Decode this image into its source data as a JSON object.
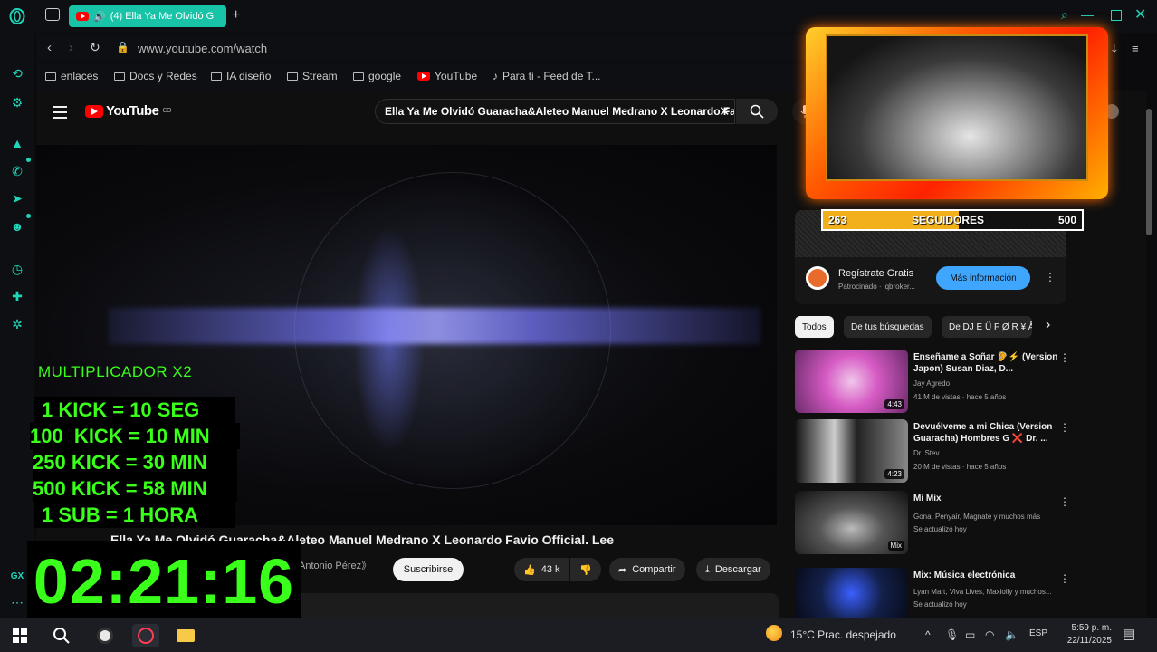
{
  "browser": {
    "tab_title": "(4) Ella Ya Me Olvidó G",
    "url": "www.youtube.com/watch",
    "bookmarks": [
      "enlaces",
      "Docs y Redes",
      "IA diseño",
      "Stream",
      "google",
      "YouTube",
      "Para ti - Feed de T..."
    ],
    "accent": "#18c3a8"
  },
  "youtube": {
    "logo": "YouTube",
    "logo_sup": "CO",
    "search_query": "Ella Ya Me Olvidó Guaracha&Aleteo Manuel Medrano X Leonardo Favi",
    "video_title": "Ella Ya Me Olvidó Guaracha&Aleteo Manuel Medrano X Leonardo Favio Official. Lee",
    "channel": "Antonio Pérez》",
    "subscribe": "Suscribirse",
    "likes": "43 k",
    "share": "Compartir",
    "download": "Descargar",
    "ad": {
      "name": "Regístrate Gratis",
      "sponsor": "Patrocinado · iqbroker...",
      "cta": "Más información"
    },
    "chips": [
      "Todos",
      "De tus búsquedas",
      "De DJ E Ü F Ø R ¥ Å"
    ],
    "recommendations": [
      {
        "title": "Enseñame a Soñar 🦻⚡ (Version Japon) Susan Diaz, D...",
        "channel": "Jay Agredo",
        "meta": "41 M de vistas · hace 5 años",
        "duration": "4:43"
      },
      {
        "title": "Devuélveme a mi Chica (Version Guaracha) Hombres G ❌ Dr. ...",
        "channel": "Dr. Stev",
        "meta": "20 M de vistas · hace 5 años",
        "duration": "4:23"
      },
      {
        "title": "Mi Mix",
        "channel": "Gona, Penyair, Magnate y muchos más",
        "meta": "Se actualizó hoy",
        "duration": "Mix"
      },
      {
        "title": "Mix: Música electrónica",
        "channel": "Lyan Mart, Viva Lives, Maxiolly y muchos...",
        "meta": "Se actualizó hoy",
        "duration": ""
      }
    ]
  },
  "overlay": {
    "followers": {
      "current": "263",
      "label": "SEGUIDORES",
      "goal": "500",
      "fraction": 0.526
    },
    "multiplier": "MULTIPLICADOR X2",
    "rules": [
      "1 KICK = 10 SEG",
      "100  KICK = 10 MIN",
      "250 KICK = 30 MIN",
      "500 KICK = 58 MIN",
      "1 SUB = 1 HORA"
    ],
    "timer": "02:21:16",
    "timer_color": "#39ff1a"
  },
  "taskbar": {
    "weather": "15°C  Prac. despejado",
    "lang": "ESP",
    "time": "5:59 p. m.",
    "date": "22/11/2025"
  }
}
